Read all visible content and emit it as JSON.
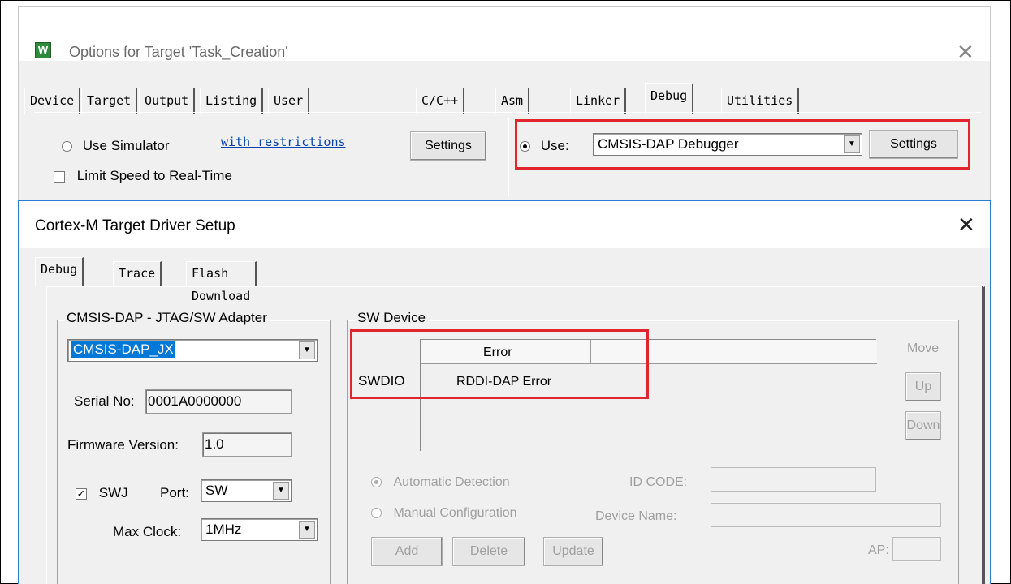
{
  "options_window": {
    "title": "Options for Target 'Task_Creation'",
    "tabs": [
      "Device",
      "Target",
      "Output",
      "Listing",
      "User",
      "C/C++",
      "Asm",
      "Linker",
      "Debug",
      "Utilities"
    ],
    "active_tab": "Debug",
    "use_simulator_label": "Use Simulator",
    "with_restrictions_link": "with restrictions",
    "left_settings_label": "Settings",
    "limit_speed_label": "Limit Speed to Real-Time",
    "use_label": "Use:",
    "debugger_value": "CMSIS-DAP Debugger",
    "right_settings_label": "Settings"
  },
  "driver_window": {
    "title": "Cortex-M Target Driver Setup",
    "tabs": [
      "Debug",
      "Trace",
      "Flash Download"
    ],
    "active_tab": "Debug",
    "adapter": {
      "group_title": "CMSIS-DAP - JTAG/SW Adapter",
      "adapter_value": "CMSIS-DAP_JX",
      "serial_label": "Serial No:",
      "serial_value": "0001A0000000",
      "firmware_label": "Firmware Version:",
      "firmware_value": "1.0",
      "swj_label": "SWJ",
      "swj_checked": true,
      "port_label": "Port:",
      "port_value": "SW",
      "max_clock_label": "Max Clock:",
      "max_clock_value": "1MHz"
    },
    "sw_device": {
      "group_title": "SW Device",
      "column_header": "Error",
      "row_label": "SWDIO",
      "row_value": "RDDI-DAP Error",
      "move_label": "Move",
      "up_label": "Up",
      "down_label": "Down",
      "auto_detect_label": "Automatic Detection",
      "manual_config_label": "Manual Configuration",
      "id_code_label": "ID CODE:",
      "device_name_label": "Device Name:",
      "add_label": "Add",
      "delete_label": "Delete",
      "update_label": "Update",
      "ap_label": "AP:"
    }
  },
  "colors": {
    "highlight_box": "#e0262c",
    "active_window_border": "#2b7cd3",
    "selection": "#0078d7"
  }
}
